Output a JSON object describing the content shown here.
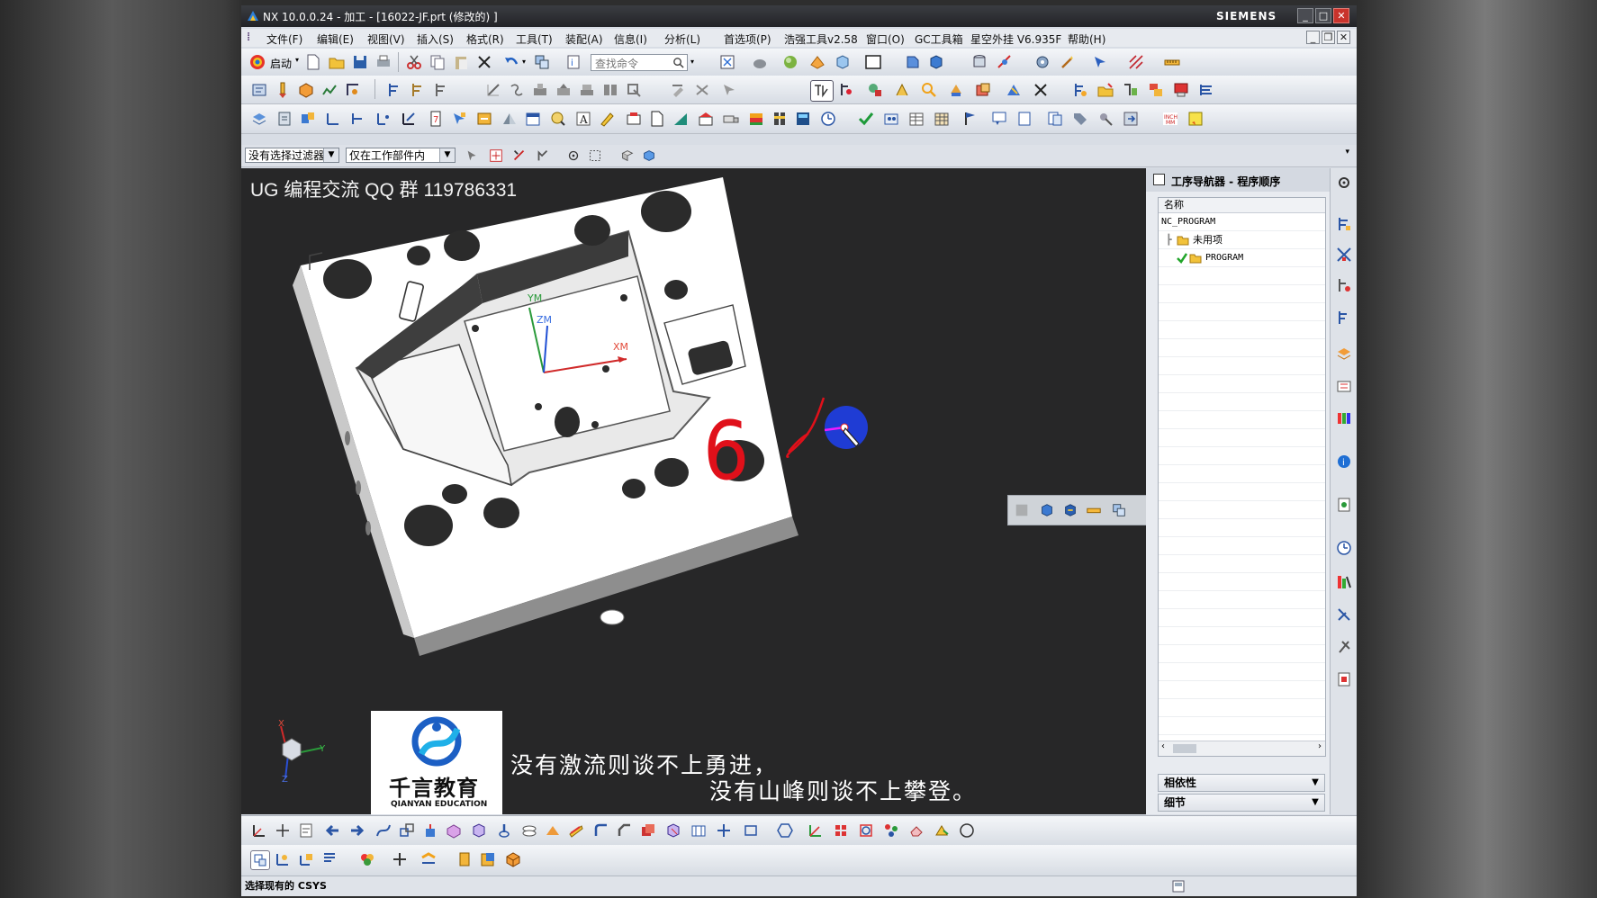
{
  "window": {
    "title": "NX 10.0.0.24 - 加工 - [16022-JF.prt  (修改的) ]",
    "brand": "SIEMENS",
    "controls": [
      "_",
      "□",
      "✕"
    ]
  },
  "menu": {
    "items": [
      "文件(F)",
      "编辑(E)",
      "视图(V)",
      "插入(S)",
      "格式(R)",
      "工具(T)",
      "装配(A)",
      "信息(I)",
      "分析(L)",
      "首选项(P)",
      "浩强工具v2.58",
      "窗口(O)",
      "GC工具箱",
      "星空外挂 V6.935F",
      "帮助(H)"
    ],
    "doc_controls": [
      "_",
      "❐",
      "✕"
    ]
  },
  "toolbar": {
    "start_label": "启动",
    "search_placeholder": "查找命令"
  },
  "filters": {
    "selection_filter": "没有选择过滤器",
    "scope": "仅在工作部件内"
  },
  "viewport": {
    "overlay_text": "UG 编程交流 QQ 群 119786331",
    "axis_labels": {
      "ym": "YM",
      "zm": "ZM",
      "xm": "XM"
    },
    "triad_labels": {
      "x": "X",
      "y": "Y",
      "z": "Z"
    },
    "annotation": "6"
  },
  "watermark": {
    "brand_cn": "千言教育",
    "brand_en": "QIANYAN EDUCATION"
  },
  "subtitle": {
    "line1": "没有激流则谈不上勇进，",
    "line2": "没有山峰则谈不上攀登。"
  },
  "navigator": {
    "title": "工序导航器 - 程序顺序",
    "column_header": "名称",
    "rows": [
      {
        "label": "NC_PROGRAM"
      },
      {
        "label": "未用项"
      },
      {
        "label": "PROGRAM"
      }
    ],
    "sections": [
      "相依性",
      "细节"
    ]
  },
  "status_bar": {
    "message": "选择现有的 CSYS"
  },
  "colors": {
    "viewport_bg": "#272728",
    "accent_blue": "#1a3cd8",
    "annotation_red": "#e0101a",
    "check_green": "#22a52a"
  }
}
